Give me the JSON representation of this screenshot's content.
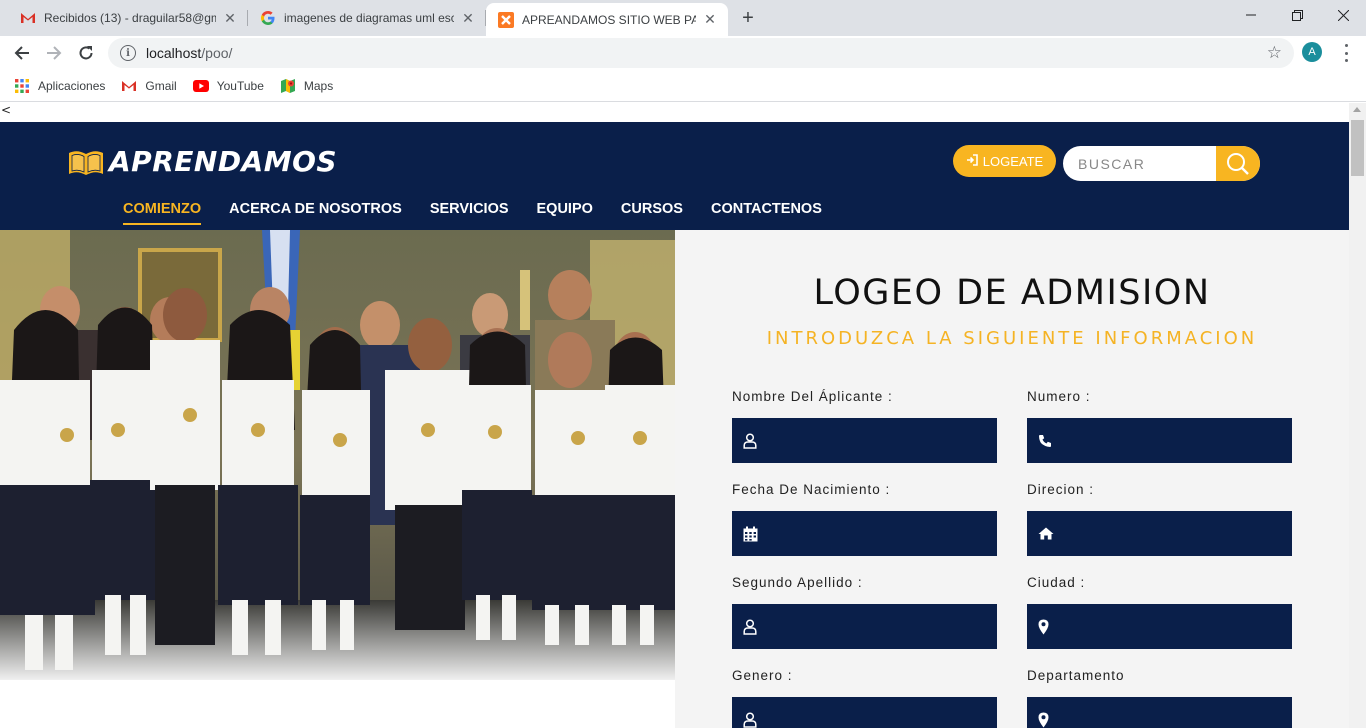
{
  "browser": {
    "tabs": [
      {
        "title": "Recibidos (13) - draguilar58@gm",
        "icon": "gmail-icon",
        "active": false
      },
      {
        "title": "imagenes de diagramas uml escu",
        "icon": "google-icon",
        "active": false
      },
      {
        "title": "APREANDAMOS SITIO WEB PARA",
        "icon": "xampp-icon",
        "active": true
      }
    ],
    "url_host": "localhost",
    "url_path": "/poo/",
    "profile_initial": "A",
    "bookmarks": [
      {
        "label": "Aplicaciones",
        "icon": "apps-grid-icon"
      },
      {
        "label": "Gmail",
        "icon": "gmail-icon"
      },
      {
        "label": "YouTube",
        "icon": "youtube-icon"
      },
      {
        "label": "Maps",
        "icon": "maps-icon"
      }
    ]
  },
  "page": {
    "stray_text": "<",
    "brand": "APRENDAMOS",
    "login_label": "LOGEATE",
    "search_placeholder": "BUSCAR",
    "nav": [
      {
        "label": "COMIENZO",
        "active": true
      },
      {
        "label": "ACERCA DE NOSOTROS",
        "active": false
      },
      {
        "label": "SERVICIOS",
        "active": false
      },
      {
        "label": "EQUIPO",
        "active": false
      },
      {
        "label": "CURSOS",
        "active": false
      },
      {
        "label": "CONTACTENOS",
        "active": false
      }
    ],
    "form": {
      "title": "LOGEO DE ADMISION",
      "subtitle": "INTRODUZCA LA SIGUIENTE INFORMACION",
      "fields": [
        {
          "label": "Nombre Del Áplicante :",
          "icon": "user-icon"
        },
        {
          "label": "Numero :",
          "icon": "phone-icon"
        },
        {
          "label": "Fecha De Nacimiento :",
          "icon": "calendar-icon"
        },
        {
          "label": "Direcion :",
          "icon": "home-icon"
        },
        {
          "label": "Segundo Apellido :",
          "icon": "user-icon"
        },
        {
          "label": "Ciudad :",
          "icon": "map-marker-icon"
        },
        {
          "label": "Genero :",
          "icon": "user-icon"
        },
        {
          "label": "Departamento",
          "icon": "map-marker-icon"
        }
      ]
    }
  },
  "colors": {
    "navy": "#0a1f4a",
    "accent": "#f8b521",
    "panel_bg": "#f4f4f4"
  }
}
